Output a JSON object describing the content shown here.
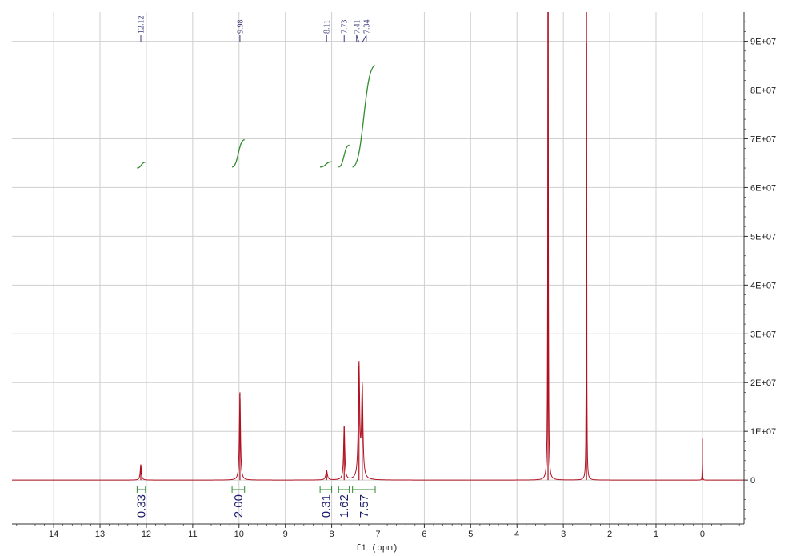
{
  "chart_data": {
    "type": "line",
    "xlabel": "f1 (ppm)",
    "xlim": [
      14.9,
      -0.9
    ],
    "ylim": [
      -9000000,
      96000000
    ],
    "x_ticks": [
      14,
      13,
      12,
      11,
      10,
      9,
      8,
      7,
      6,
      5,
      4,
      3,
      2,
      1,
      0
    ],
    "y_ticks": [
      {
        "value": 0,
        "label": "0"
      },
      {
        "value": 10000000,
        "label": "1E+07"
      },
      {
        "value": 20000000,
        "label": "2E+07"
      },
      {
        "value": 30000000,
        "label": "3E+07"
      },
      {
        "value": 40000000,
        "label": "4E+07"
      },
      {
        "value": 50000000,
        "label": "5E+07"
      },
      {
        "value": 60000000,
        "label": "6E+07"
      },
      {
        "value": 70000000,
        "label": "7E+07"
      },
      {
        "value": 80000000,
        "label": "8E+07"
      },
      {
        "value": 90000000,
        "label": "9E+07"
      }
    ],
    "grid": true,
    "colors": {
      "spectrum": "#b01020",
      "integral": "#2e8b2e",
      "grid": "#cfcfcf",
      "axis": "#333333",
      "labels": "#1b1b6e"
    },
    "peaks": [
      {
        "ppm": 12.12,
        "height": 3200000,
        "width": 0.03
      },
      {
        "ppm": 9.98,
        "height": 18000000,
        "width": 0.028
      },
      {
        "ppm": 8.11,
        "height": 2000000,
        "width": 0.04
      },
      {
        "ppm": 7.73,
        "height": 11000000,
        "width": 0.03
      },
      {
        "ppm": 7.41,
        "height": 23500000,
        "width": 0.035
      },
      {
        "ppm": 7.34,
        "height": 19000000,
        "width": 0.035
      },
      {
        "ppm": 3.33,
        "height": 140000000,
        "width": 0.012
      },
      {
        "ppm": 2.5,
        "height": 140000000,
        "width": 0.008
      },
      {
        "ppm": 0.0,
        "height": 8500000,
        "width": 0.006
      }
    ],
    "peak_labels": [
      {
        "ppm": 12.12,
        "label": "12.12"
      },
      {
        "ppm": 9.98,
        "label": "9.98"
      },
      {
        "ppm": 8.11,
        "label": "8.11"
      },
      {
        "ppm": 7.73,
        "label": "7.73"
      },
      {
        "ppm": 7.41,
        "label": "7.41"
      },
      {
        "ppm": 7.34,
        "label": "7.34"
      }
    ],
    "integrals": [
      {
        "from": 12.2,
        "to": 12.02,
        "value": "0.33",
        "curve_base": 64000000,
        "curve_top": 65200000
      },
      {
        "from": 10.15,
        "to": 9.88,
        "value": "2.00",
        "curve_base": 64200000,
        "curve_top": 69800000
      },
      {
        "from": 8.25,
        "to": 8.0,
        "value": "0.31",
        "curve_base": 64200000,
        "curve_top": 65300000
      },
      {
        "from": 7.85,
        "to": 7.62,
        "value": "1.62",
        "curve_base": 64200000,
        "curve_top": 68700000
      },
      {
        "from": 7.55,
        "to": 7.06,
        "value": "7.57",
        "curve_base": 64200000,
        "curve_top": 85000000
      }
    ]
  }
}
